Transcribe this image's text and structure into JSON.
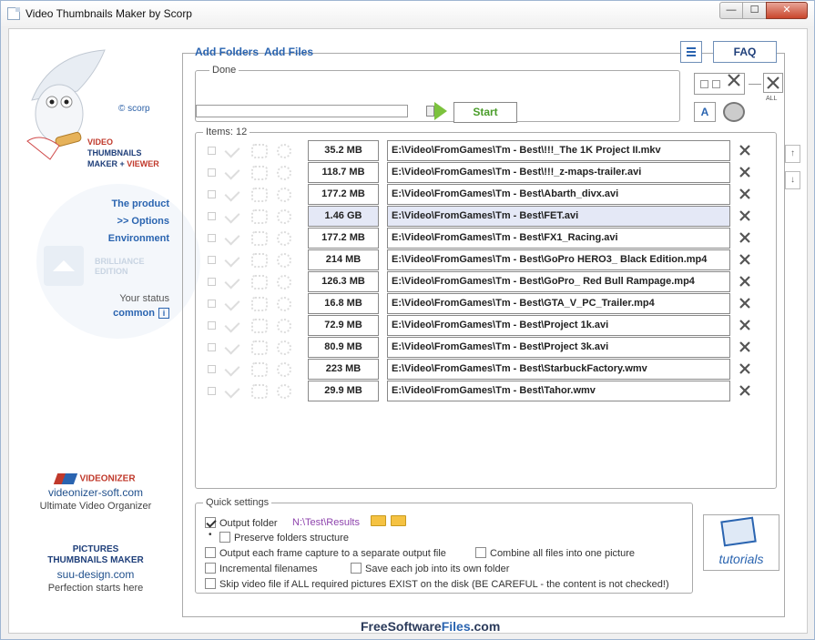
{
  "window": {
    "title": "Video Thumbnails Maker by Scorp",
    "min_glyph": "—",
    "max_glyph": "☐",
    "close_glyph": "✕"
  },
  "sidebar": {
    "copyright": "© scorp",
    "brand_line1": "VIDEO",
    "brand_line2": "THUMBNAILS",
    "brand_line3a": "MAKER + ",
    "brand_line3b": "VIEWER",
    "nav": {
      "product": "The product",
      "options": ">> Options",
      "environment": "Environment"
    },
    "brilliance_line1": "BRILLIANCE",
    "brilliance_line2": "EDITION",
    "status_label": "Your status",
    "status_value": "common",
    "status_info_glyph": "i",
    "promo1": {
      "title": "VIDEONIZER",
      "url": "videonizer-soft.com",
      "tagline": "Ultimate Video Organizer"
    },
    "promo2": {
      "title_line1": "PICTURES",
      "title_line2": "THUMBNAILS MAKER",
      "url": "suu-design.com",
      "tagline": "Perfection starts here"
    }
  },
  "toolbar": {
    "add_folders": "Add Folders",
    "add_files": "Add Files",
    "faq": "FAQ",
    "done_label": "Done",
    "start": "Start",
    "all_label": "ALL",
    "font_tool_glyph": "A"
  },
  "items": {
    "label": "Items: 12",
    "rows": [
      {
        "size": "35.2 MB",
        "path": "E:\\Video\\FromGames\\Tm - Best\\!!!_The 1K Project II.mkv"
      },
      {
        "size": "118.7 MB",
        "path": "E:\\Video\\FromGames\\Tm - Best\\!!!_z-maps-trailer.avi"
      },
      {
        "size": "177.2 MB",
        "path": "E:\\Video\\FromGames\\Tm - Best\\Abarth_divx.avi"
      },
      {
        "size": "1.46 GB",
        "path": "E:\\Video\\FromGames\\Tm - Best\\FET.avi"
      },
      {
        "size": "177.2 MB",
        "path": "E:\\Video\\FromGames\\Tm - Best\\FX1_Racing.avi"
      },
      {
        "size": "214 MB",
        "path": "E:\\Video\\FromGames\\Tm - Best\\GoPro HERO3_ Black Edition.mp4"
      },
      {
        "size": "126.3 MB",
        "path": "E:\\Video\\FromGames\\Tm - Best\\GoPro_ Red Bull Rampage.mp4"
      },
      {
        "size": "16.8 MB",
        "path": "E:\\Video\\FromGames\\Tm - Best\\GTA_V_PC_Trailer.mp4"
      },
      {
        "size": "72.9 MB",
        "path": "E:\\Video\\FromGames\\Tm - Best\\Project 1k.avi"
      },
      {
        "size": "80.9 MB",
        "path": "E:\\Video\\FromGames\\Tm - Best\\Project 3k.avi"
      },
      {
        "size": "223 MB",
        "path": "E:\\Video\\FromGames\\Tm - Best\\StarbuckFactory.wmv"
      },
      {
        "size": "29.9 MB",
        "path": "E:\\Video\\FromGames\\Tm - Best\\Tahor.wmv"
      }
    ],
    "selected_index": 3,
    "scroll_up_glyph": "↑",
    "scroll_down_glyph": "↓"
  },
  "quick_settings": {
    "label": "Quick settings",
    "output_folder": "Output folder",
    "output_path": "N:\\Test\\Results",
    "bullet": "•",
    "preserve": "Preserve folders structure",
    "each_frame": "Output each frame capture to a separate output file",
    "combine": "Combine all files into one picture",
    "incremental": "Incremental filenames",
    "own_folder": "Save each job into its own folder",
    "skip": "Skip video file if ALL required pictures EXIST on the disk (BE CAREFUL - the content is not checked!)"
  },
  "tutorials": {
    "label": "tutorials"
  },
  "watermark": {
    "part1": "FreeSoftware",
    "part2": "Files",
    "part3": ".com"
  }
}
